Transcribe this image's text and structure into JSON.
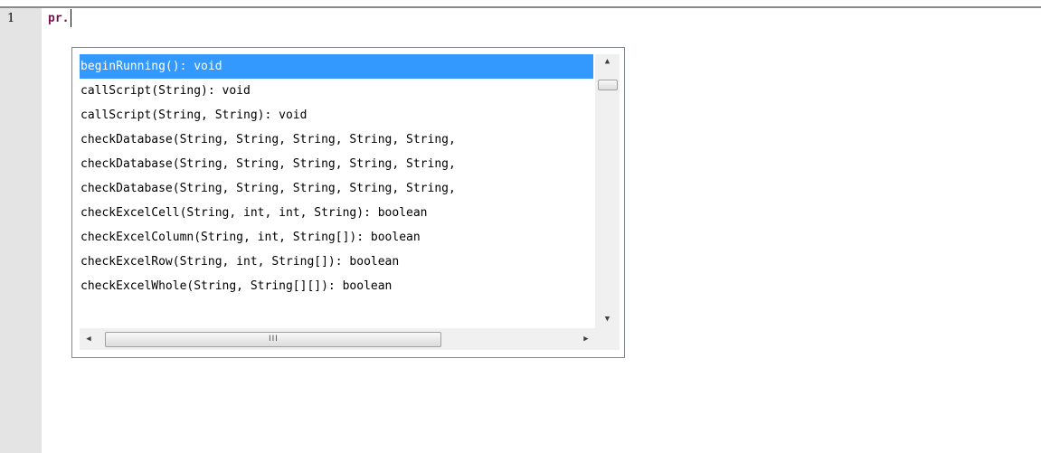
{
  "editor": {
    "line_number": "1",
    "code": "pr."
  },
  "autocomplete": {
    "items": [
      "beginRunning(): void",
      "callScript(String): void",
      "callScript(String, String): void",
      "checkDatabase(String, String, String, String, String,",
      "checkDatabase(String, String, String, String, String,",
      "checkDatabase(String, String, String, String, String,",
      "checkExcelCell(String, int, int, String): boolean",
      "checkExcelColumn(String, int, String[]): boolean",
      "checkExcelRow(String, int, String[]): boolean",
      "checkExcelWhole(String, String[][]): boolean"
    ],
    "selected_index": 0,
    "colors": {
      "selection": "#3399ff",
      "keyword": "#7a0f4e",
      "gutter": "#e4e4e4"
    },
    "icons": {
      "scroll_up": "triangle-up-icon",
      "scroll_down": "triangle-down-icon",
      "scroll_left": "triangle-left-icon",
      "scroll_right": "triangle-right-icon",
      "grip": "grip-icon"
    },
    "grip_glyph": "III"
  }
}
